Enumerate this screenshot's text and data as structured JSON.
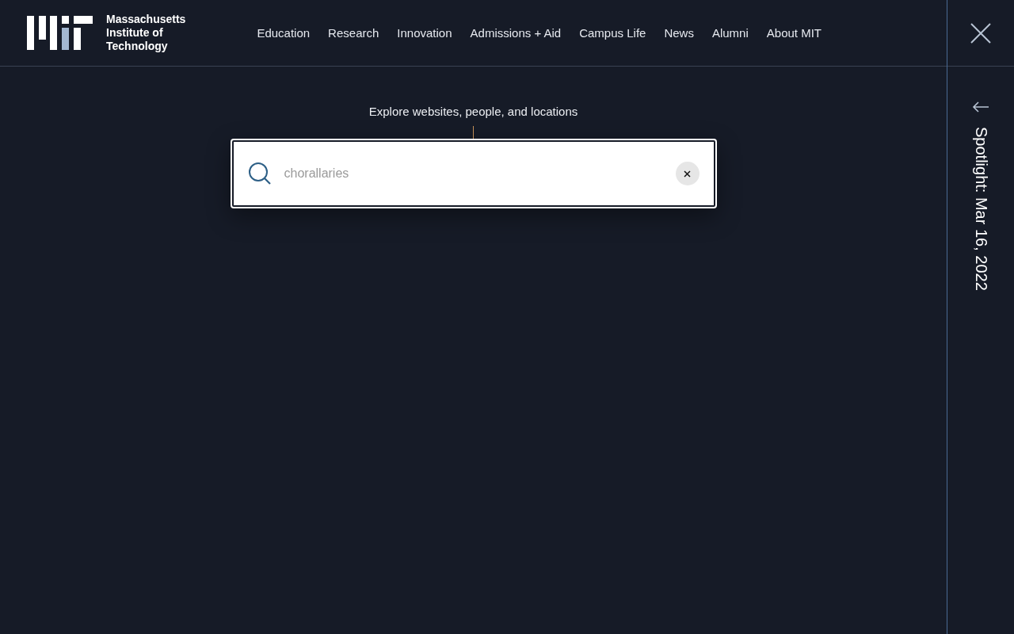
{
  "header": {
    "logo_text": [
      "Massachusetts",
      "Institute of",
      "Technology"
    ],
    "nav": [
      {
        "label": "Education"
      },
      {
        "label": "Research"
      },
      {
        "label": "Innovation"
      },
      {
        "label": "Admissions + Aid"
      },
      {
        "label": "Campus Life"
      },
      {
        "label": "News"
      },
      {
        "label": "Alumni"
      },
      {
        "label": "About MIT"
      }
    ]
  },
  "search": {
    "label": "Explore websites, people, and locations",
    "value": "chorallaries"
  },
  "spotlight": {
    "label": "Spotlight: Mar 16, 2022"
  }
}
